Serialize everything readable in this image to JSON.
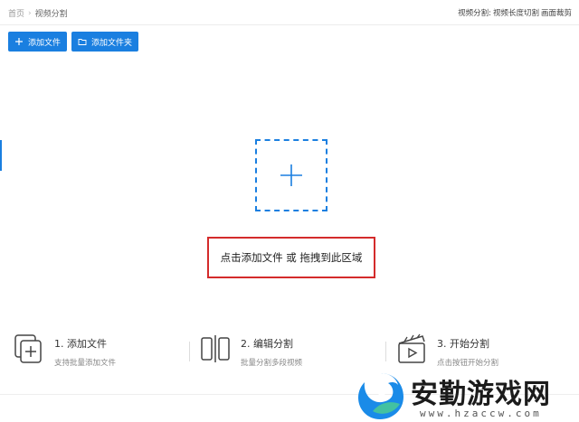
{
  "breadcrumb": {
    "home": "首页",
    "separator": "›",
    "current": "视频分割"
  },
  "tools": {
    "items": [
      "视频分割:",
      "视频长度切割",
      "画面裁剪"
    ]
  },
  "toolbar": {
    "add_file": "添加文件",
    "add_folder": "添加文件夹"
  },
  "dropzone": {
    "hint": "点击添加文件 或 拖拽到此区域"
  },
  "steps": [
    {
      "title": "1. 添加文件",
      "desc": "支持批量添加文件",
      "icon": "add-file-icon"
    },
    {
      "title": "2. 编辑分割",
      "desc": "批量分割多段视频",
      "icon": "split-icon"
    },
    {
      "title": "3. 开始分割",
      "desc": "点击按钮开始分割",
      "icon": "clapper-play-icon"
    }
  ],
  "watermark": {
    "name": "安勤游戏网",
    "url": "www.hzaccw.com"
  },
  "colors": {
    "accent": "#1a7fe0",
    "highlight_border": "#d42b2b"
  }
}
